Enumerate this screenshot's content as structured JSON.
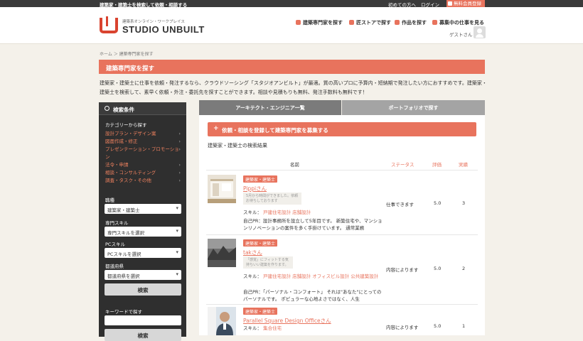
{
  "topbar": {
    "tagline": "建築家・建築士を検索して依頼・相談する",
    "links": [
      "初めての方へ",
      "ログイン"
    ],
    "register": "無料会員登録"
  },
  "header": {
    "logo_sub": "建築系オンライン・ワークプレイス",
    "logo_main": "STUDIO UNBUILT",
    "nav": [
      "建築専門家を探す",
      "匠ストアで探す",
      "作品を探す",
      "募集中の仕事を見る"
    ],
    "user": "ゲストさん"
  },
  "breadcrumb": "ホーム ＞ 建築専門家を探す",
  "page_title": "建築専門家を探す",
  "intro": "建築家・建築士に仕事を依頼・発注するなら、クラウドソーシング「スタジオアンビルト」が最適。質の高いプロに予算内・短納期で発注したい方におすすめです。建築家・建築士を検索して、素早く依頼・外注・委託先を探すことができます。相談や見積もりも無料、発注手数料も無料です！",
  "sidebar": {
    "title": "検索条件",
    "category_label": "カテゴリーから探す",
    "categories": [
      "設計プラン・デザイン案",
      "図面作成・修正",
      "プレゼンテーション・プロモーション",
      "法令・申請",
      "相談・コンサルティング",
      "調査・タスク・その他"
    ],
    "job_label": "職種",
    "job_value": "建築家・建築士",
    "skill_label": "専門スキル",
    "skill_value": "専門スキルを選択",
    "pc_label": "PCスキル",
    "pc_value": "PCスキルを選択",
    "pref_label": "都道府県",
    "pref_value": "都道府県を選択",
    "search_btn": "検索",
    "keyword_label": "キーワードで探す",
    "search_btn2": "検索"
  },
  "tabs": [
    "アーキテクト・エンジニア一覧",
    "ポートフォリオで探す"
  ],
  "post_button": "依頼・相談を登録して建築専門家を募集する",
  "results_title": "建築家・建築士の検索結果",
  "table_headers": [
    "名前",
    "ステータス",
    "評価",
    "実績"
  ],
  "results": [
    {
      "badge": "建築家・建築士",
      "name": "Pippiさん",
      "note": "5月から時間ができました。依頼お待ちしております",
      "skill_label": "スキル：",
      "skills": [
        "戸建住宅設計",
        "店舗設計"
      ],
      "pr": "自己PR：設計事務所を設立して5年目です。 新築住宅や、マンションリノベーションの案件を多く手掛けています。 通常業務",
      "status": "仕事できます",
      "rating": "5.0",
      "count": "3"
    },
    {
      "badge": "建築家・建築士",
      "name": "takさん",
      "note": "「感覚」にフィットする気持ちいい建築を作ります。",
      "skill_label": "スキル：",
      "skills": [
        "戸建住宅設計",
        "店舗設計",
        "オフィスビル設計",
        "公共建築設計"
      ],
      "pr": "自己PR：「パーソナル・コンフォート」 それは\"あなた\"にとってのパーソナルです。 ポピュラーな心地よさではなく、人生",
      "status": "内容によります",
      "rating": "5.0",
      "count": "2"
    },
    {
      "badge": "建築家・建築士",
      "name": "Parallel Square Design Officeさん",
      "skill_label": "スキル：",
      "skills": [
        "集合住宅"
      ],
      "status": "内容によります",
      "rating": "5.0",
      "count": "1"
    }
  ],
  "colors": {
    "accent": "#e8735d",
    "sidebar": "#2f2f2f",
    "logo": "#d9432f"
  }
}
